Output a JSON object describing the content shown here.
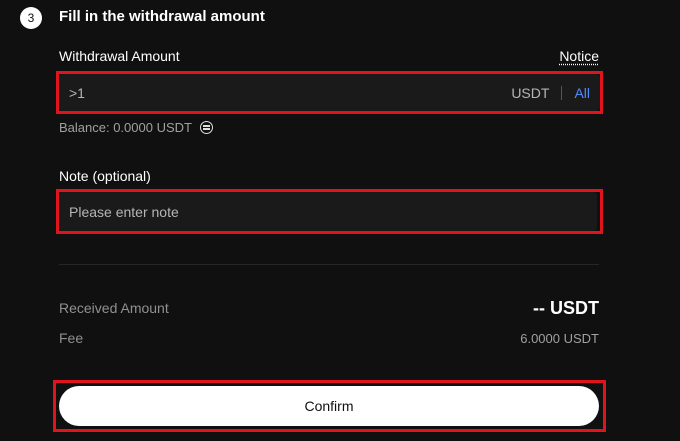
{
  "step": {
    "number": "3",
    "title": "Fill in the withdrawal amount"
  },
  "withdrawal": {
    "label": "Withdrawal Amount",
    "notice_label": "Notice",
    "placeholder": ">1",
    "unit": "USDT",
    "all_label": "All"
  },
  "balance": {
    "text": "Balance: 0.0000 USDT"
  },
  "note": {
    "label": "Note (optional)",
    "placeholder": "Please enter note"
  },
  "summary": {
    "received_label": "Received Amount",
    "received_value": "-- USDT",
    "fee_label": "Fee",
    "fee_value": "6.0000 USDT"
  },
  "actions": {
    "confirm_label": "Confirm"
  },
  "colors": {
    "background": "#101010",
    "highlight": "#e0141b",
    "link_blue": "#4e8bff"
  },
  "icons": {
    "balance_swap": "swap-circle-icon"
  }
}
